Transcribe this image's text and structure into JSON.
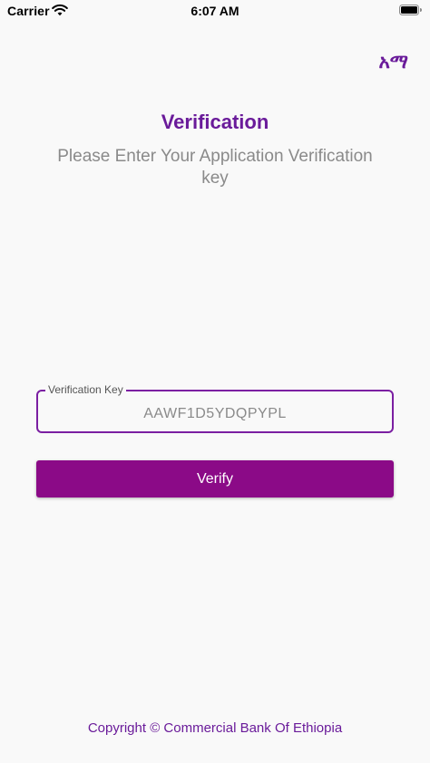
{
  "status_bar": {
    "carrier": "Carrier",
    "time": "6:07 AM",
    "wifi_icon": "wifi-icon",
    "battery_icon": "battery-icon"
  },
  "header": {
    "language_toggle": "አማ"
  },
  "main": {
    "title": "Verification",
    "subtitle": "Please Enter Your Application Verification key",
    "field": {
      "label": "Verification Key",
      "value": "AAWF1D5YDQPYPL"
    },
    "verify_label": "Verify"
  },
  "footer": {
    "copyright": "Copyright © Commercial Bank Of Ethiopia"
  },
  "colors": {
    "accent": "#6a1b9a",
    "button": "#8b0a87",
    "field_border": "#7b1fa2",
    "muted_text": "#8a8a8a",
    "background": "#f9f9f9"
  }
}
